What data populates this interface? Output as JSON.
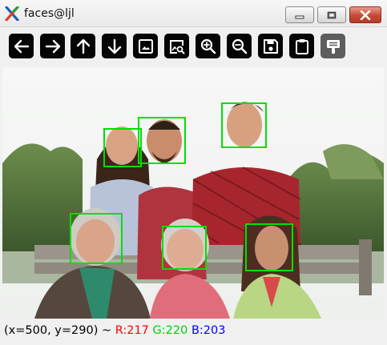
{
  "window": {
    "title": "faces@ljl",
    "controls": [
      "minimize",
      "maximize",
      "close"
    ]
  },
  "toolbar": {
    "buttons": [
      {
        "name": "pan-left",
        "icon": "arrow-left-icon"
      },
      {
        "name": "pan-right",
        "icon": "arrow-right-icon"
      },
      {
        "name": "pan-up",
        "icon": "arrow-up-icon"
      },
      {
        "name": "pan-down",
        "icon": "arrow-down-icon"
      },
      {
        "name": "zoom-to-window",
        "icon": "image-icon"
      },
      {
        "name": "zoom-fit",
        "icon": "image-search-icon"
      },
      {
        "name": "zoom-in",
        "icon": "zoom-in-icon"
      },
      {
        "name": "zoom-out",
        "icon": "zoom-out-icon"
      },
      {
        "name": "save-image",
        "icon": "save-icon"
      },
      {
        "name": "copy-clipboard",
        "icon": "clipboard-icon"
      },
      {
        "name": "properties",
        "icon": "properties-icon"
      }
    ]
  },
  "image": {
    "description_icon": "group-photo",
    "faces_detected": 6
  },
  "status": {
    "position": "(x=500, y=290) ~ ",
    "r": "R:217",
    "g": "G:220",
    "b": "B:203"
  },
  "colors": {
    "detection_box": "#00e000",
    "status_r": "#ff0000",
    "status_g": "#00d000",
    "status_b": "#0000ff",
    "toolbar_button": "#050505"
  }
}
